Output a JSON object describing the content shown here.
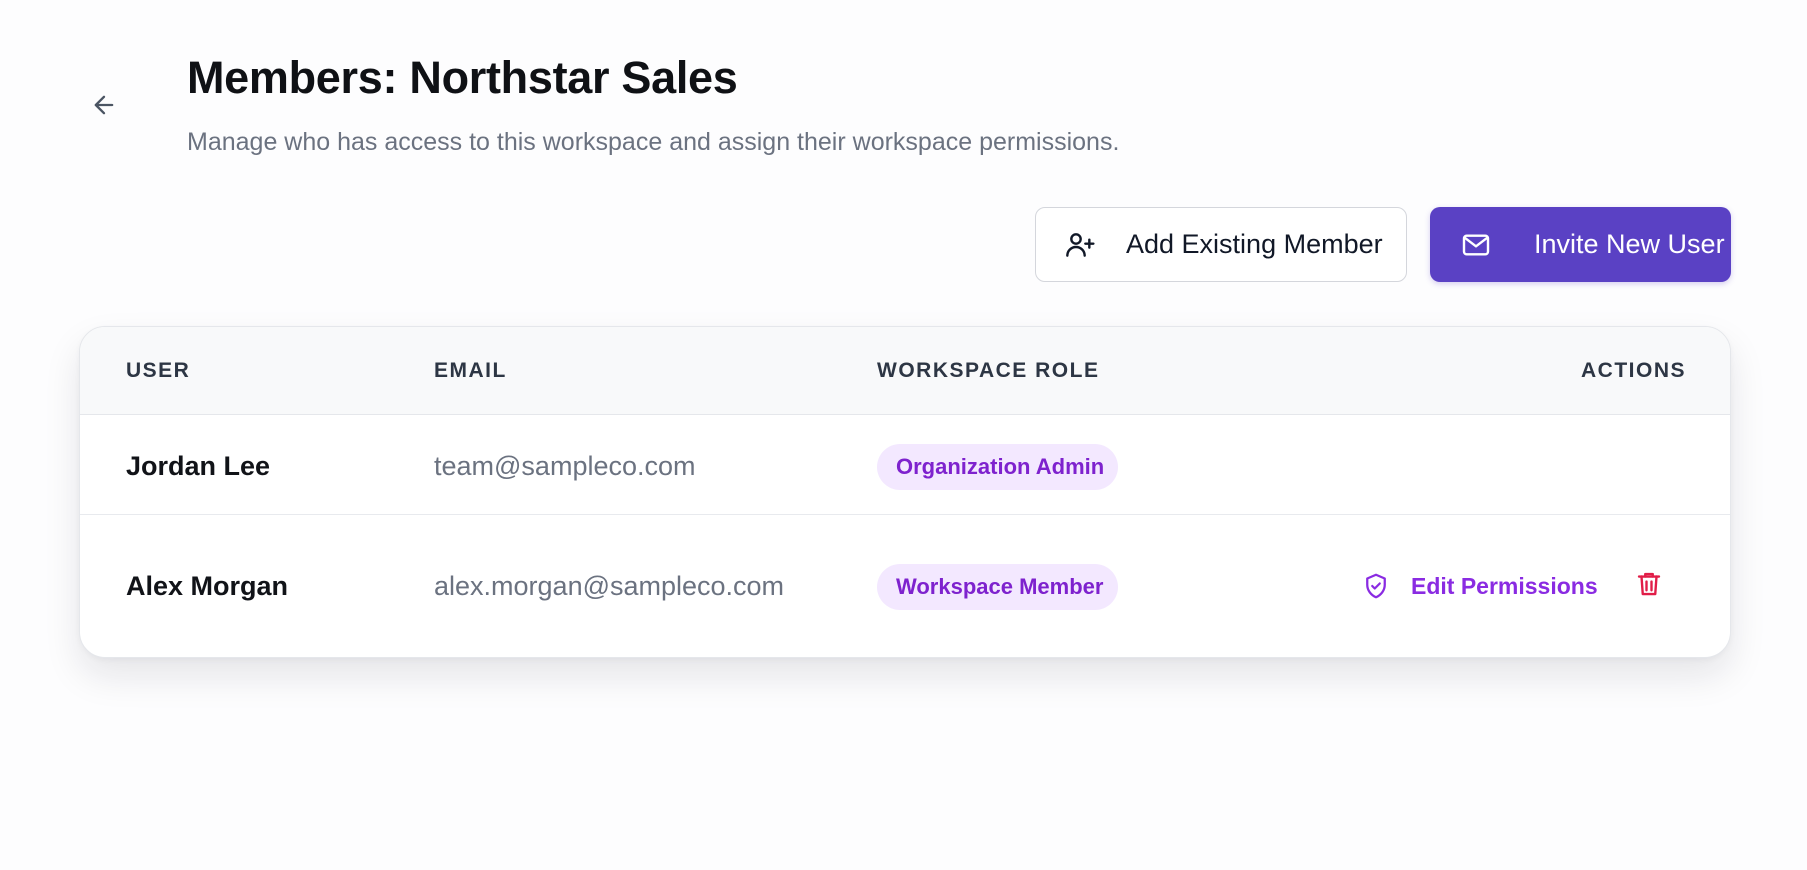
{
  "header": {
    "title": "Members: Northstar Sales",
    "subtitle": "Manage who has access to this workspace and assign their workspace permissions."
  },
  "actions": {
    "add_existing_label": "Add Existing Member",
    "invite_label": "Invite New User"
  },
  "table": {
    "columns": [
      "USER",
      "EMAIL",
      "WORKSPACE ROLE",
      "ACTIONS"
    ],
    "rows": [
      {
        "name": "Jordan Lee",
        "email": "team@sampleco.com",
        "role": "Organization Admin"
      },
      {
        "name": "Alex Morgan",
        "email": "alex.morgan@sampleco.com",
        "role": "Workspace Member",
        "edit_label": "Edit Permissions"
      }
    ]
  },
  "icons": {
    "back": "arrow-left-icon",
    "add_member": "user-plus-icon",
    "invite": "mail-icon",
    "edit_permissions": "shield-check-icon",
    "delete": "trash-icon"
  },
  "colors": {
    "primary": "#5a41c4",
    "badge_bg": "#f3e8ff",
    "badge_text": "#7e22ce",
    "edit_accent": "#8a2be2",
    "danger": "#e11d48"
  }
}
